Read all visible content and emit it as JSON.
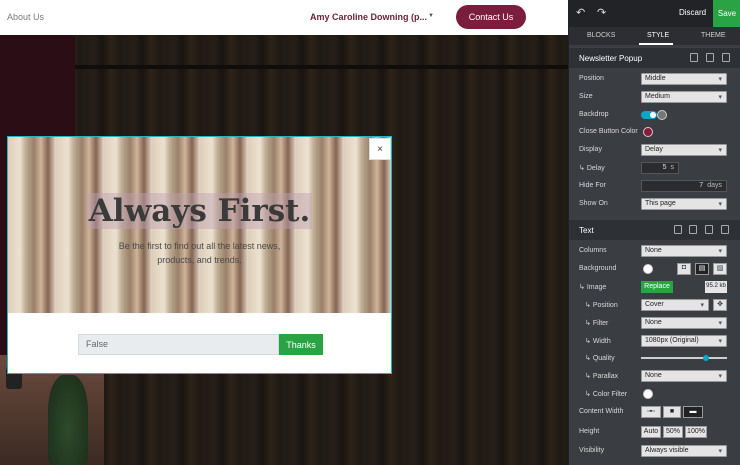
{
  "site": {
    "nav_about": "About Us",
    "owner": "Amy Caroline Downing (p...",
    "contact": "Contact Us"
  },
  "popup": {
    "title": "Always First.",
    "subtitle": "Be the first to find out all the latest news, products, and trends.",
    "input_value": "False",
    "submit": "Thanks",
    "close": "×"
  },
  "panel": {
    "discard": "Discard",
    "save": "Save",
    "tabs": [
      "BLOCKS",
      "STYLE",
      "THEME"
    ],
    "newsletter": {
      "title": "Newsletter Popup",
      "position_label": "Position",
      "position_value": "Middle",
      "size_label": "Size",
      "size_value": "Medium",
      "backdrop_label": "Backdrop",
      "close_color_label": "Close Button Color",
      "display_label": "Display",
      "display_value": "Delay",
      "delay_label": "Delay",
      "delay_value": "5",
      "delay_unit": "s",
      "hide_for_label": "Hide For",
      "hide_for_value": "7",
      "hide_for_unit": "days",
      "show_on_label": "Show On",
      "show_on_value": "This page"
    },
    "text": {
      "title": "Text",
      "columns_label": "Columns",
      "columns_value": "None",
      "background_label": "Background",
      "image_label": "Image",
      "replace": "Replace",
      "file_size": "95.2 kb",
      "position_label": "Position",
      "position_value": "Cover",
      "filter_label": "Filter",
      "filter_value": "None",
      "width_label": "Width",
      "width_value": "1080px (Original)",
      "quality_label": "Quality",
      "quality_level": 0.75,
      "parallax_label": "Parallax",
      "parallax_value": "None",
      "color_filter_label": "Color Filter",
      "content_width_label": "Content Width",
      "height_label": "Height",
      "height_options": [
        "Auto",
        "50%",
        "100%"
      ],
      "visibility_label": "Visibility",
      "visibility_value": "Always visible"
    }
  },
  "colors": {
    "accent": "#2aa345",
    "brand": "#7b1d3c",
    "toggle": "#0aa7c7",
    "close_swatch": "#8b1a3c"
  }
}
